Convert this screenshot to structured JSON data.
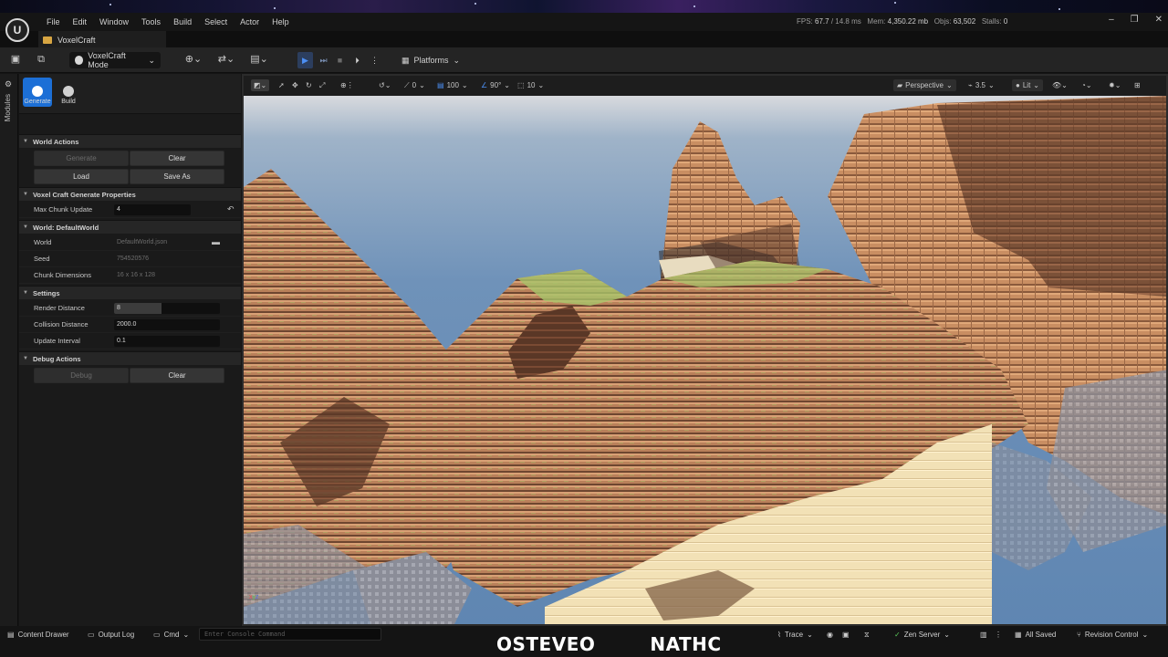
{
  "menubar": {
    "items": [
      "File",
      "Edit",
      "Window",
      "Tools",
      "Build",
      "Select",
      "Actor",
      "Help"
    ],
    "stats": {
      "fps_label": "FPS:",
      "fps": "67.7",
      "frame_time": "/ 14.8 ms",
      "mem_label": "Mem:",
      "mem": "4,350.22 mb",
      "objs_label": "Objs:",
      "objs": "63,502",
      "stalls_label": "Stalls:",
      "stalls": "0"
    }
  },
  "tabs": {
    "project": "VoxelCraft"
  },
  "toolbar": {
    "mode": "VoxelCraft Mode",
    "platforms": "Platforms"
  },
  "leftstrip": {
    "label": "Modules"
  },
  "sidepanel": {
    "mode_tabs": [
      "Generate",
      "Build"
    ],
    "world_actions": {
      "title": "World Actions",
      "generate": "Generate",
      "clear": "Clear",
      "load": "Load",
      "save_as": "Save As"
    },
    "gen_props": {
      "title": "Voxel Craft Generate Properties",
      "max_chunk_label": "Max Chunk Update",
      "max_chunk_value": "4"
    },
    "world": {
      "title": "World: DefaultWorld",
      "world_label": "World",
      "world_value": "DefaultWorld.json",
      "seed_label": "Seed",
      "seed_value": "754520576",
      "chunk_label": "Chunk Dimensions",
      "chunk_value": "16 x 16 x 128"
    },
    "settings": {
      "title": "Settings",
      "render_label": "Render Distance",
      "render_value": "8",
      "render_fill": 0.45,
      "collision_label": "Collision Distance",
      "collision_value": "2000.0",
      "update_label": "Update Interval",
      "update_value": "0.1"
    },
    "debug": {
      "title": "Debug Actions",
      "debug": "Debug",
      "clear": "Clear"
    }
  },
  "viewport": {
    "snap_rot": "0",
    "snap_grid": "100",
    "snap_angle": "90°",
    "snap_scale": "10",
    "perspective": "Perspective",
    "speed": "3.5",
    "lit": "Lit"
  },
  "statusbar": {
    "content_drawer": "Content Drawer",
    "output_log": "Output Log",
    "cmd": "Cmd",
    "console_placeholder": "Enter Console Command",
    "trace": "Trace",
    "zen_server": "Zen Server",
    "all_saved": "All Saved",
    "revision_control": "Revision Control"
  },
  "overlay": {
    "name1": "OSTEVEO",
    "name2": "NATHC"
  },
  "colors": {
    "accent_blue": "#1c6fd6",
    "play_blue": "#4c8ff3",
    "sky": "#6f92b9",
    "dirt": "#c98e62",
    "grass": "#9fb86a",
    "sand": "#f2e1b6"
  }
}
